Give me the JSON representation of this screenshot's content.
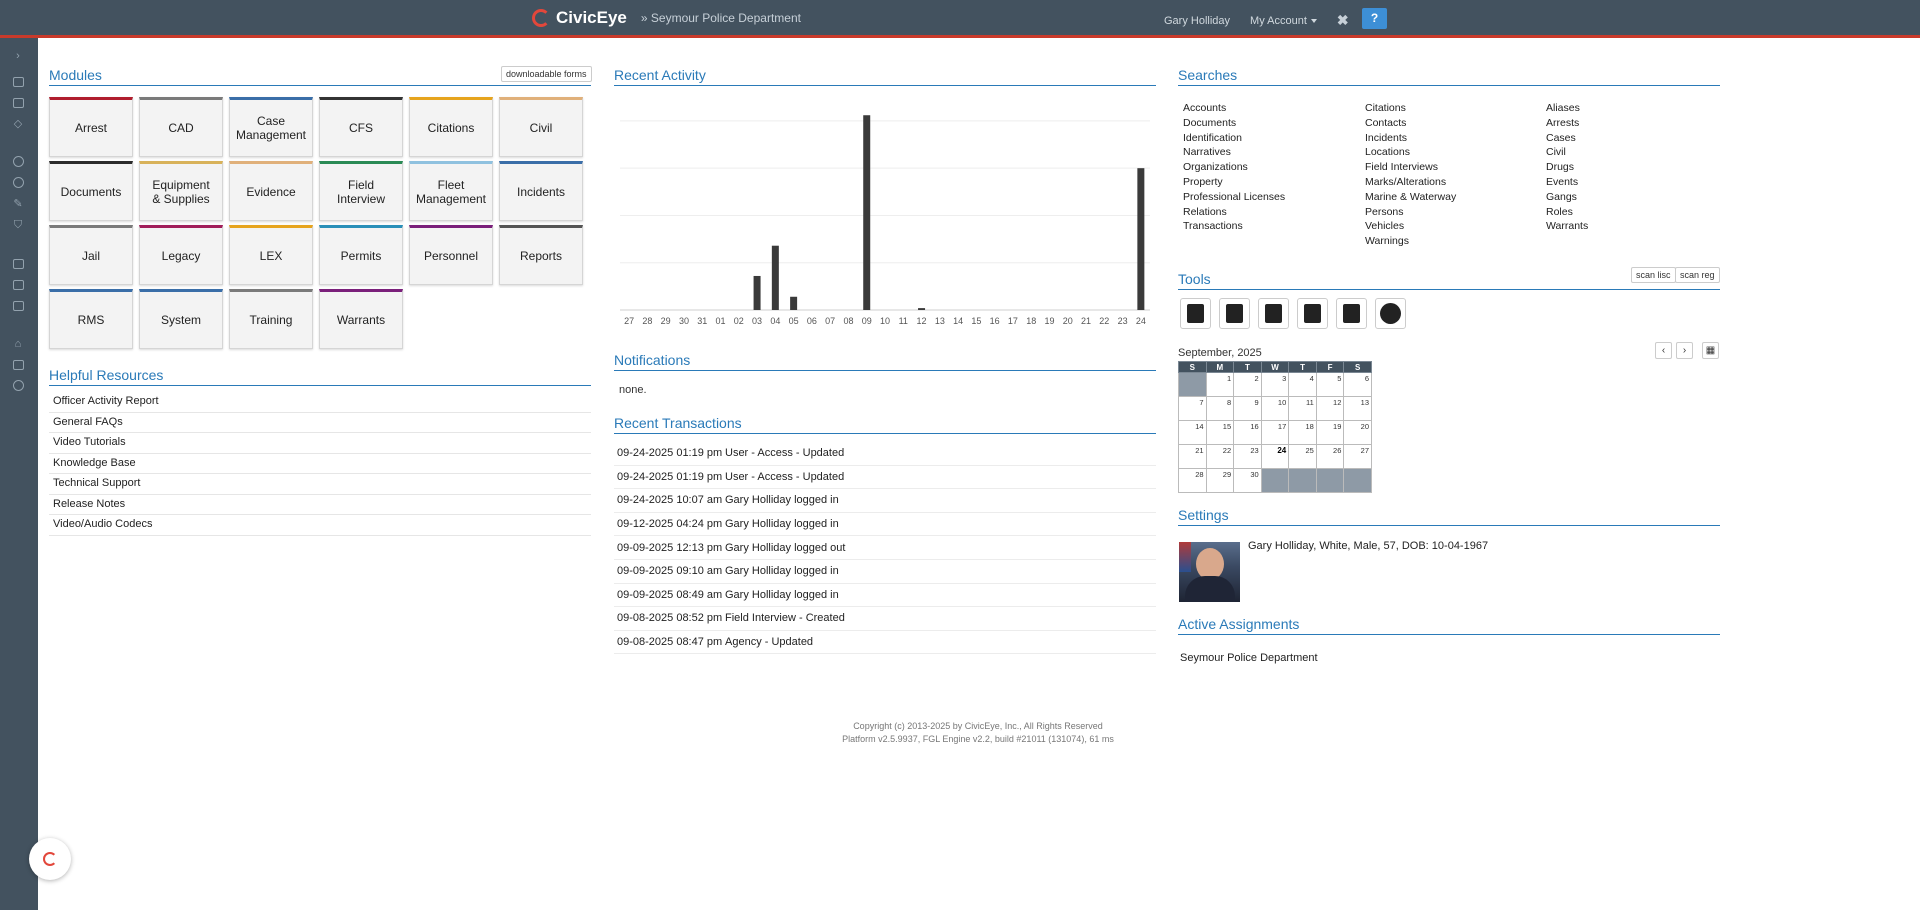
{
  "header": {
    "brand": "CivicEye",
    "department": "» Seymour Police Department",
    "user": "Gary Holliday",
    "account": "My Account",
    "close": "✖",
    "help": "?"
  },
  "modules": {
    "title": "Modules",
    "forms_button": "downloadable forms",
    "tiles": [
      {
        "label": "Arrest",
        "color": "#b01e2e"
      },
      {
        "label": "CAD",
        "color": "#7a7a7a"
      },
      {
        "label": "Case\nManagement",
        "color": "#3a6ea8"
      },
      {
        "label": "CFS",
        "color": "#333333"
      },
      {
        "label": "Citations",
        "color": "#e6a41e"
      },
      {
        "label": "Civil",
        "color": "#e0b07a"
      },
      {
        "label": "Documents",
        "color": "#2b2b2b"
      },
      {
        "label": "Equipment\n& Supplies",
        "color": "#d8b25a"
      },
      {
        "label": "Evidence",
        "color": "#e0b07a"
      },
      {
        "label": "Field\nInterview",
        "color": "#2a8a55"
      },
      {
        "label": "Fleet\nManagement",
        "color": "#8fc1df"
      },
      {
        "label": "Incidents",
        "color": "#3a6ea8"
      },
      {
        "label": "Jail",
        "color": "#7a7a7a"
      },
      {
        "label": "Legacy",
        "color": "#a11e5a"
      },
      {
        "label": "LEX",
        "color": "#e6a41e"
      },
      {
        "label": "Permits",
        "color": "#2a8fb8"
      },
      {
        "label": "Personnel",
        "color": "#7a1f7a"
      },
      {
        "label": "Reports",
        "color": "#555555"
      },
      {
        "label": "RMS",
        "color": "#3a6ea8"
      },
      {
        "label": "System",
        "color": "#3a6ea8"
      },
      {
        "label": "Training",
        "color": "#7a7a7a"
      },
      {
        "label": "Warrants",
        "color": "#7a1f7a"
      }
    ]
  },
  "resources": {
    "title": "Helpful Resources",
    "items": [
      "Officer Activity Report",
      "General FAQs",
      "Video Tutorials",
      "Knowledge Base",
      "Technical Support",
      "Release Notes",
      "Video/Audio Codecs"
    ]
  },
  "activity": {
    "title": "Recent Activity"
  },
  "chart_data": {
    "type": "bar",
    "categories": [
      "27",
      "28",
      "29",
      "30",
      "31",
      "01",
      "02",
      "03",
      "04",
      "05",
      "06",
      "07",
      "08",
      "09",
      "10",
      "11",
      "12",
      "13",
      "14",
      "15",
      "16",
      "17",
      "18",
      "19",
      "20",
      "21",
      "22",
      "23",
      "24"
    ],
    "values": [
      0,
      0,
      0,
      0,
      0,
      0,
      0,
      18,
      34,
      7,
      0,
      0,
      0,
      103,
      0,
      0,
      1,
      0,
      0,
      0,
      0,
      0,
      0,
      0,
      0,
      0,
      0,
      0,
      75
    ],
    "ylim": [
      0,
      110
    ],
    "grid": true,
    "color": "#3a3a3a"
  },
  "notifications": {
    "title": "Notifications",
    "text": "none."
  },
  "transactions": {
    "title": "Recent Transactions",
    "rows": [
      {
        "date": "09-24-2025 01:19 pm",
        "text": "User - Access - Updated"
      },
      {
        "date": "09-24-2025 01:19 pm",
        "text": "User - Access - Updated"
      },
      {
        "date": "09-24-2025 10:07 am",
        "text": "Gary Holliday logged in"
      },
      {
        "date": "09-12-2025 04:24 pm",
        "text": "Gary Holliday logged in"
      },
      {
        "date": "09-09-2025 12:13 pm",
        "text": "Gary Holliday logged out"
      },
      {
        "date": "09-09-2025 09:10 am",
        "text": "Gary Holliday logged in"
      },
      {
        "date": "09-09-2025 08:49 am",
        "text": "Gary Holliday logged in"
      },
      {
        "date": "09-08-2025 08:52 pm",
        "text": "Field Interview - Created"
      },
      {
        "date": "09-08-2025 08:47 pm",
        "text": "Agency - Updated"
      }
    ]
  },
  "searches": {
    "title": "Searches",
    "col1": [
      "Accounts",
      "Documents",
      "Identification",
      "Narratives",
      "Organizations",
      "Property",
      "Professional Licenses",
      "Relations",
      "Transactions"
    ],
    "col2": [
      "Citations",
      "Contacts",
      "Incidents",
      "Locations",
      "Field Interviews",
      "Marks/Alterations",
      "Marine & Waterway",
      "Persons",
      "Vehicles",
      "Warnings"
    ],
    "col3": [
      "Aliases",
      "Arrests",
      "Cases",
      "Civil",
      "Drugs",
      "Events",
      "Gangs",
      "Roles",
      "Warrants"
    ]
  },
  "tools": {
    "title": "Tools",
    "scan_lisc": "scan lisc",
    "scan_reg": "scan reg",
    "icons": [
      "calculator-icon",
      "calendar-icon",
      "map-icon",
      "document-icon",
      "notebook-icon",
      "clock-icon"
    ]
  },
  "calendar": {
    "month": "September, 2025",
    "prev": "‹",
    "next": "›",
    "days": [
      "S",
      "M",
      "T",
      "W",
      "T",
      "F",
      "S"
    ],
    "weeks": [
      [
        "",
        "1",
        "2",
        "3",
        "4",
        "5",
        "6"
      ],
      [
        "7",
        "8",
        "9",
        "10",
        "11",
        "12",
        "13"
      ],
      [
        "14",
        "15",
        "16",
        "17",
        "18",
        "19",
        "20"
      ],
      [
        "21",
        "22",
        "23",
        "24",
        "25",
        "26",
        "27"
      ],
      [
        "28",
        "29",
        "30",
        "",
        "",
        "",
        ""
      ]
    ],
    "today": "24"
  },
  "settings": {
    "title": "Settings",
    "profile": "Gary Holliday, White, Male, 57, DOB: 10-04-1967"
  },
  "assignments": {
    "title": "Active Assignments",
    "item": "Seymour Police Department"
  },
  "footer": {
    "line1": "Copyright (c) 2013-2025 by CivicEye, Inc., All Rights Reserved",
    "line2": "Platform v2.5.9937, FGL Engine v2.2, build #21011 (131074), 61 ms"
  }
}
